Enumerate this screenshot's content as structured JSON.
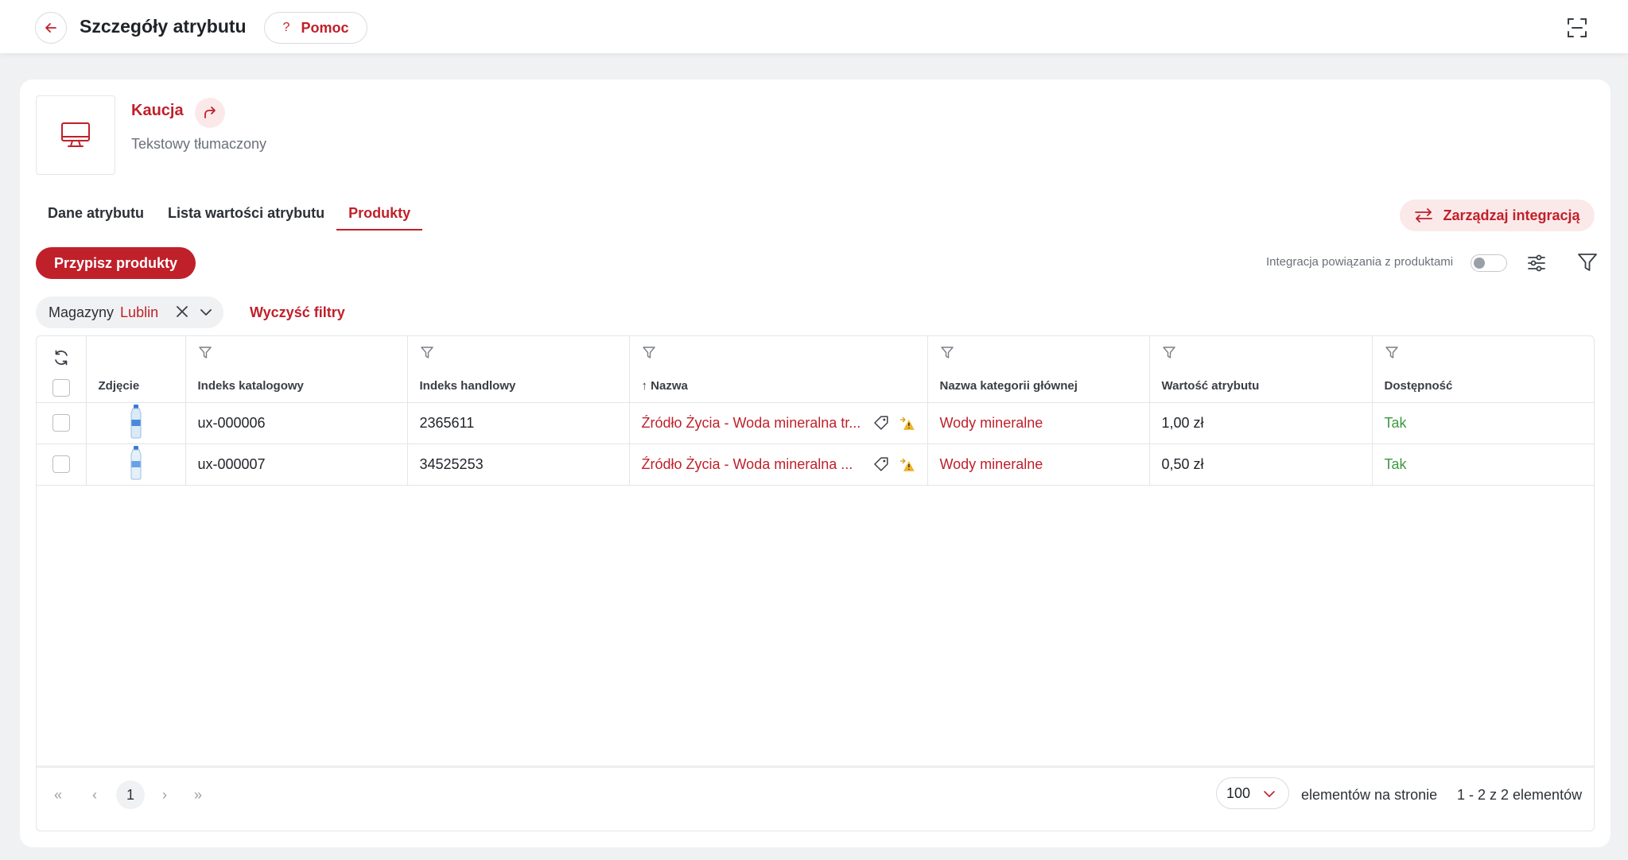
{
  "header": {
    "title": "Szczegóły atrybutu",
    "help_label": "Pomoc",
    "help_icon": "?"
  },
  "attribute": {
    "name": "Kaucja",
    "type": "Tekstowy tłumaczony",
    "icon": "monitor-icon"
  },
  "tabs": [
    {
      "label": "Dane atrybutu"
    },
    {
      "label": "Lista wartości atrybutu"
    },
    {
      "label": "Produkty",
      "active": true
    }
  ],
  "actions": {
    "manage_integration": "Zarządzaj integracją",
    "assign_products": "Przypisz produkty",
    "integration_toggle_label": "Integracja powiązania z produktami",
    "integration_toggle_on": false,
    "clear_filters": "Wyczyść filtry"
  },
  "filter_chip": {
    "key": "Magazyny",
    "value": "Lublin"
  },
  "table": {
    "columns": [
      "Zdjęcie",
      "Indeks katalogowy",
      "Indeks handlowy",
      "Nazwa",
      "Nazwa kategorii głównej",
      "Wartość atrybutu",
      "Dostępność"
    ],
    "sort_indicator": "↑",
    "rows": [
      {
        "catalog_index": "ux-000006",
        "trade_index": "2365611",
        "name": "Źródło Życia - Woda mineralna tr...",
        "category": "Wody mineralne",
        "value": "1,00 zł",
        "availability": "Tak"
      },
      {
        "catalog_index": "ux-000007",
        "trade_index": "34525253",
        "name": "Źródło Życia - Woda mineralna ...",
        "category": "Wody mineralne",
        "value": "0,50 zł",
        "availability": "Tak"
      }
    ]
  },
  "pagination": {
    "current_page": "1",
    "per_page": "100",
    "per_page_label": "elementów na stronie",
    "range_label": "1 - 2 z 2 elementów"
  },
  "colors": {
    "accent": "#c0202a",
    "accent_soft": "#fbe9ea",
    "success": "#3a9a3e",
    "background": "#f0f1f3"
  }
}
